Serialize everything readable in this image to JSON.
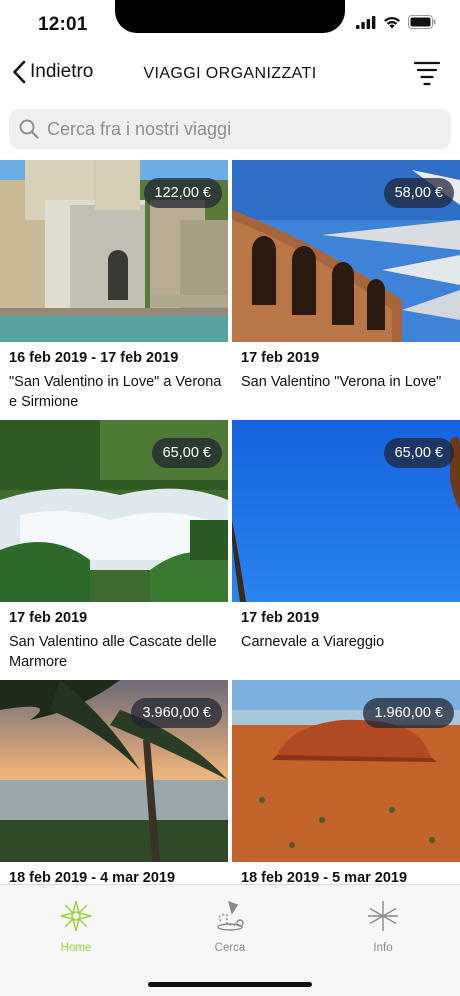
{
  "status": {
    "time": "12:01"
  },
  "nav": {
    "back_label": "Indietro",
    "title": "VIAGGI ORGANIZZATI"
  },
  "search": {
    "placeholder": "Cerca fra i nostri viaggi"
  },
  "trips": [
    {
      "price": "122,00 €",
      "date": "16 feb 2019 - 17 feb 2019",
      "title": "\"San Valentino in Love\" a Verona e Sirmione"
    },
    {
      "price": "58,00 €",
      "date": "17 feb 2019",
      "title": "San Valentino \"Verona in Love\""
    },
    {
      "price": "65,00 €",
      "date": "17 feb 2019",
      "title": "San Valentino alle Cascate delle Marmore"
    },
    {
      "price": "65,00 €",
      "date": "17 feb 2019",
      "title": "Carnevale a Viareggio"
    },
    {
      "price": "3.960,00 €",
      "date": "18 feb 2019 - 4 mar 2019",
      "title": ""
    },
    {
      "price": "1.960,00 €",
      "date": "18 feb 2019 - 5 mar 2019",
      "title": ""
    }
  ],
  "tabs": [
    {
      "label": "Home",
      "icon": "star-flower-icon",
      "active": true
    },
    {
      "label": "Cerca",
      "icon": "map-route-icon",
      "active": false
    },
    {
      "label": "Info",
      "icon": "asterisk-icon",
      "active": false
    }
  ],
  "colors": {
    "accent": "#9bd13a",
    "price_badge": "#1e2332"
  }
}
